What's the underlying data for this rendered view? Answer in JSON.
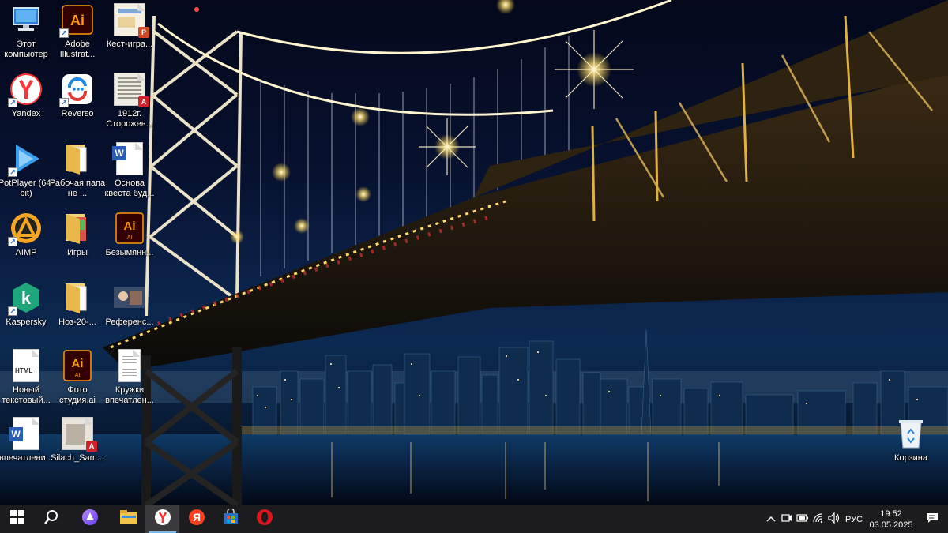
{
  "desktop": {
    "icons": [
      {
        "label": "Этот компьютер",
        "icon": "computer-icon"
      },
      {
        "label": "Adobe Illustrat...",
        "icon": "illustrator-icon"
      },
      {
        "label": "Кест-игра...",
        "icon": "powerpoint-file-icon"
      },
      {
        "label": "Yandex",
        "icon": "yandex-browser-icon"
      },
      {
        "label": "Reverso",
        "icon": "reverso-icon"
      },
      {
        "label": "1912г. Сторожев...",
        "icon": "pdf-file-icon"
      },
      {
        "label": "PotPlayer (64-bit)",
        "icon": "potplayer-icon"
      },
      {
        "label": "Рабочая папа не ...",
        "icon": "folder-icon"
      },
      {
        "label": "Основа квеста буд...",
        "icon": "word-file-icon"
      },
      {
        "label": "AIMP",
        "icon": "aimp-icon"
      },
      {
        "label": "Игры",
        "icon": "folder-icon"
      },
      {
        "label": "Безымянн...",
        "icon": "ai-file-icon"
      },
      {
        "label": "Kaspersky",
        "icon": "kaspersky-icon"
      },
      {
        "label": "Ноз-20-...",
        "icon": "folder-icon"
      },
      {
        "label": "Референс...",
        "icon": "image-file-icon"
      },
      {
        "label": "Новый текстовый...",
        "icon": "html-file-icon"
      },
      {
        "label": "Фото студия.ai",
        "icon": "ai-file-icon"
      },
      {
        "label": "Кружки впечатлен...",
        "icon": "text-file-icon"
      },
      {
        "label": "впечатлени...",
        "icon": "word-file-icon"
      },
      {
        "label": "Silach_Sam...",
        "icon": "pdf-file-icon"
      },
      {
        "label": "Корзина",
        "icon": "recycle-bin-icon"
      }
    ]
  },
  "taskbar": {
    "apps": [
      {
        "name": "start",
        "icon": "windows-start-icon"
      },
      {
        "name": "search",
        "icon": "search-icon"
      },
      {
        "name": "alice",
        "icon": "alice-assistant-icon"
      },
      {
        "name": "explorer",
        "icon": "file-explorer-icon"
      },
      {
        "name": "yandex",
        "icon": "yandex-browser-icon"
      },
      {
        "name": "yandex-search",
        "icon": "yandex-icon"
      },
      {
        "name": "store",
        "icon": "microsoft-store-icon"
      },
      {
        "name": "opera",
        "icon": "opera-icon"
      }
    ],
    "tray": {
      "language": "РУС",
      "time": "19:52",
      "date": "03.05.2025"
    }
  },
  "colors": {
    "taskbar": "#1c1c1e",
    "accent": "#76b9ed"
  }
}
